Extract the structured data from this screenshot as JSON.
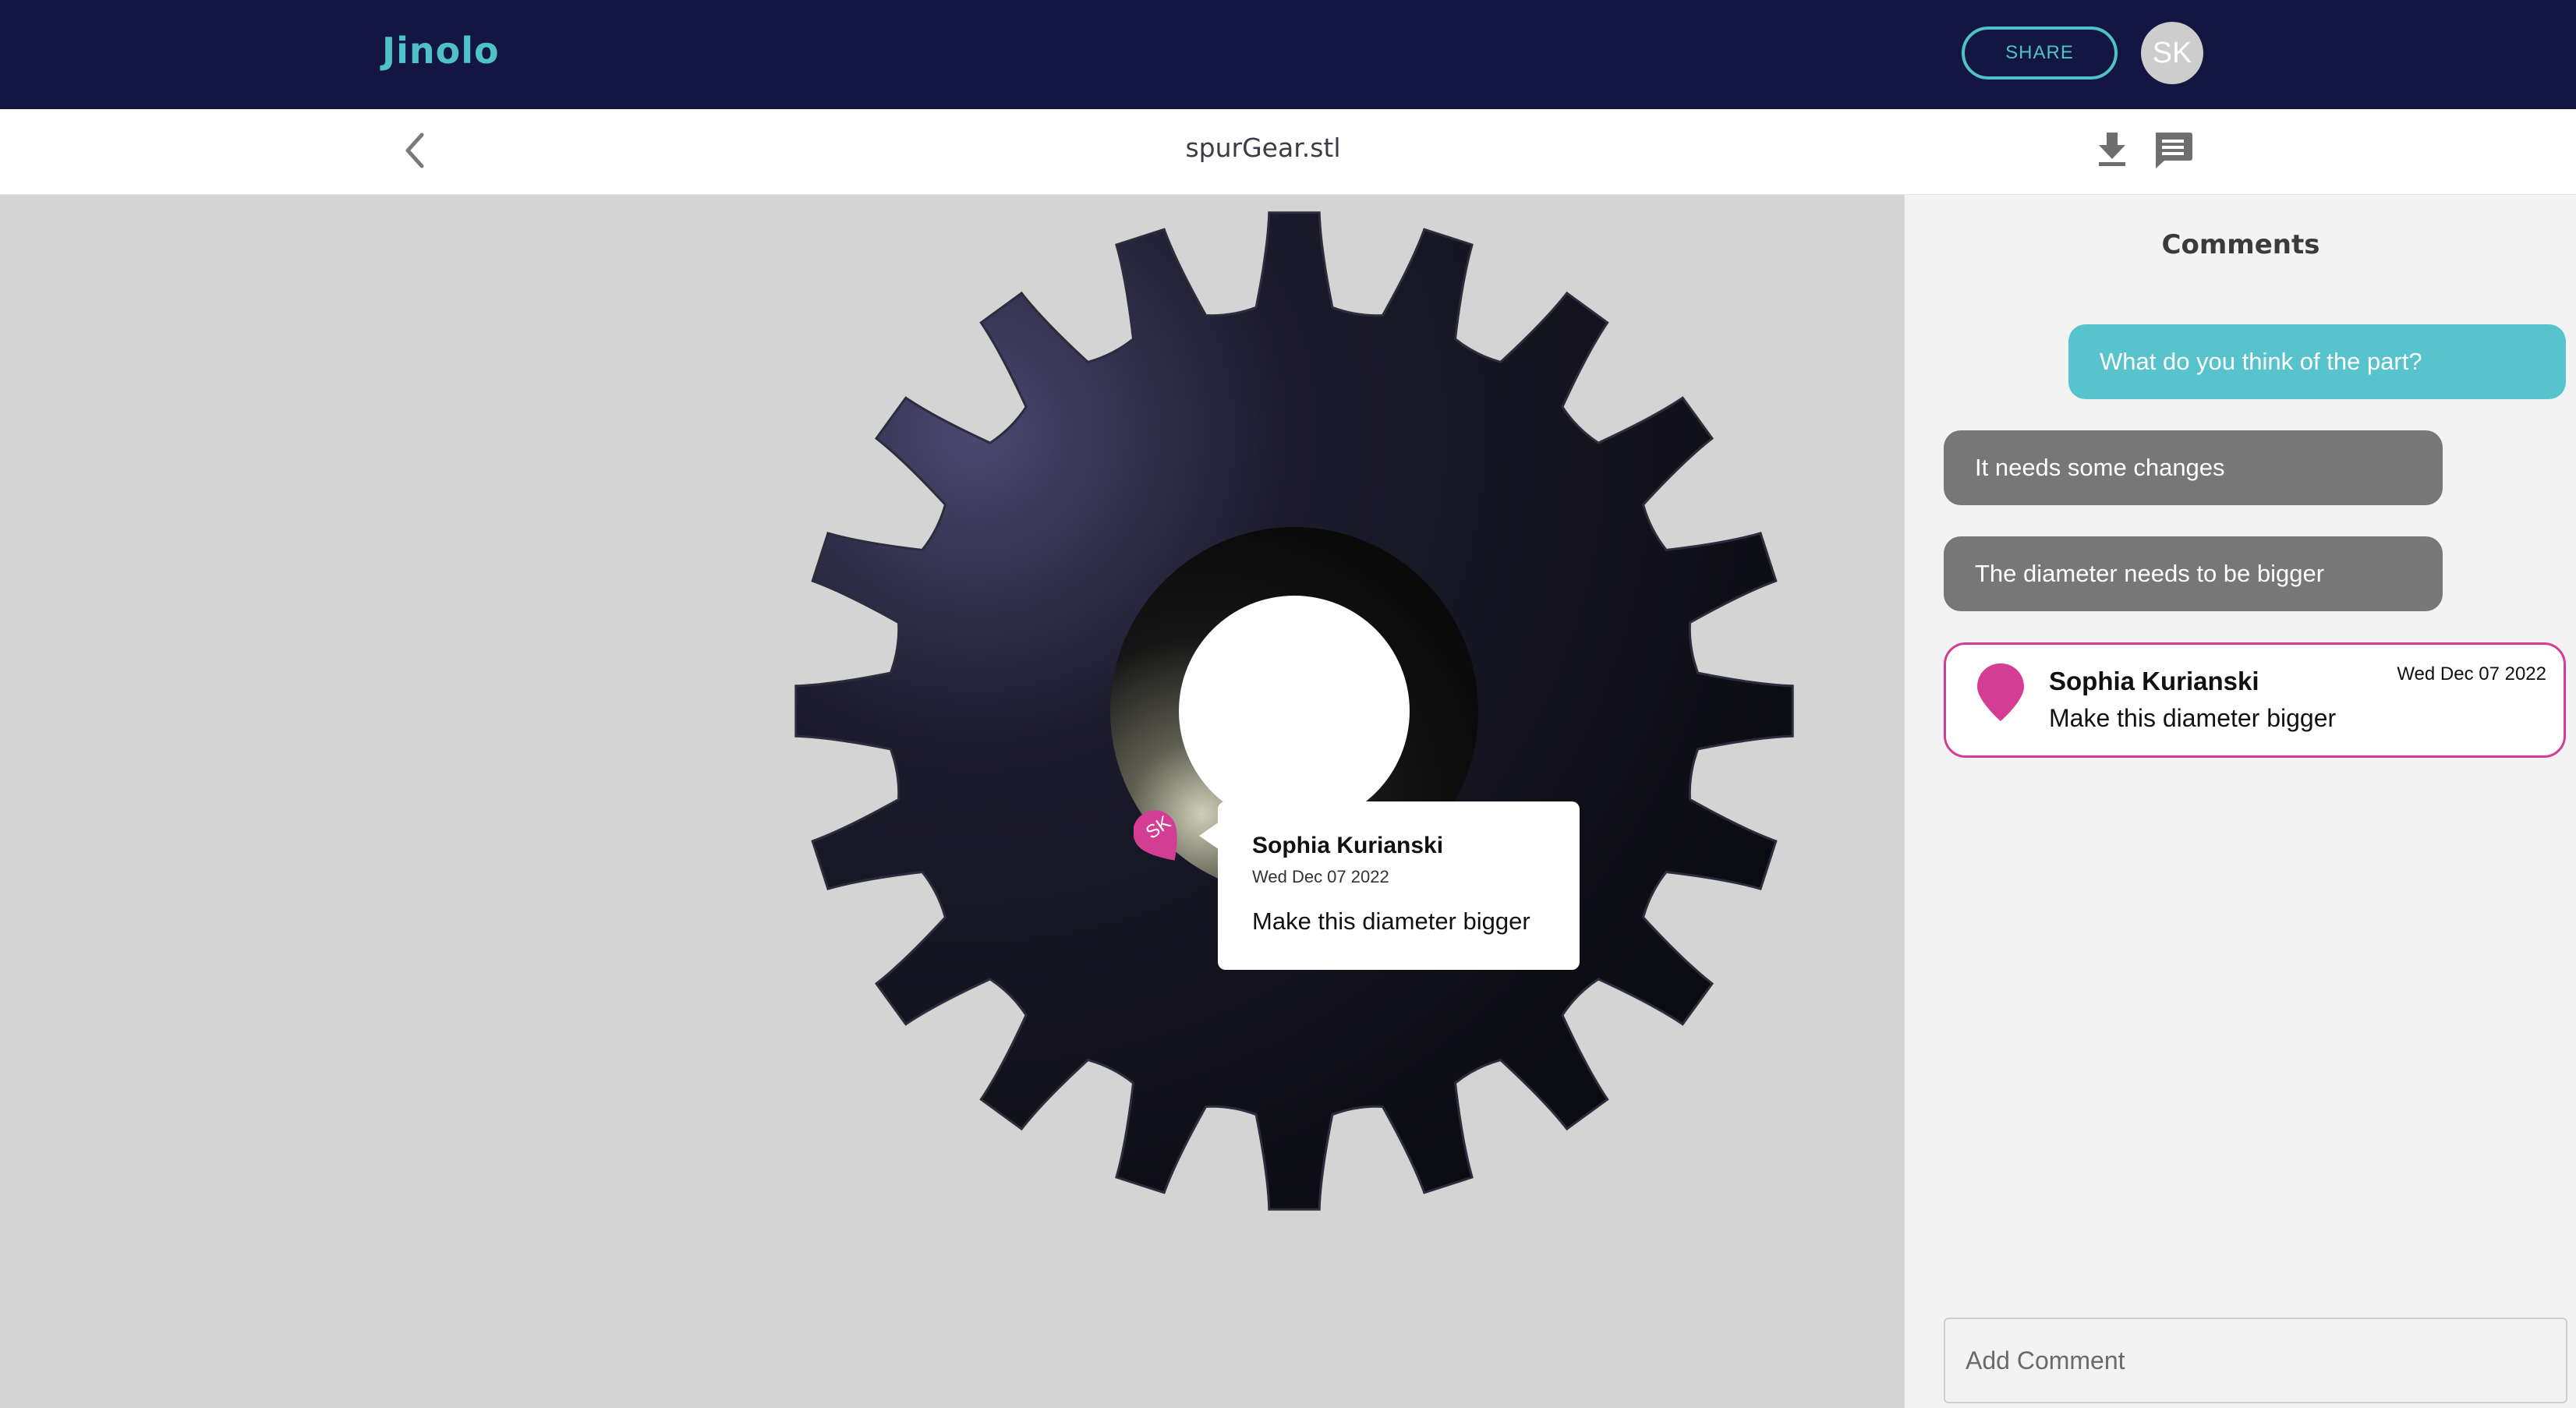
{
  "header": {
    "brand": "Jinolo",
    "share_label": "SHARE",
    "avatar_initials": "SK"
  },
  "subheader": {
    "file_name": "spurGear.stl",
    "icons": [
      "back-chevron-icon",
      "download-icon",
      "comments-icon"
    ]
  },
  "viewer": {
    "pin_initials": "SK",
    "popup": {
      "name": "Sophia Kurianski",
      "date": "Wed Dec 07 2022",
      "text": "Make this diameter bigger"
    }
  },
  "comments": {
    "title": "Comments",
    "messages": [
      {
        "text": "What do you think of the part?",
        "from": "self"
      },
      {
        "text": "It needs some changes",
        "from": "other"
      },
      {
        "text": "The diameter needs to be bigger",
        "from": "other"
      }
    ],
    "pinned": {
      "name": "Sophia Kurianski",
      "date": "Wed Dec 07 2022",
      "text": "Make this diameter bigger"
    },
    "input_placeholder": "Add Comment"
  },
  "colors": {
    "header_bg": "#131640",
    "accent": "#4fc1cb",
    "pin": "#d43d94",
    "bubble_other": "#777777",
    "viewer_bg": "#d4d4d4"
  }
}
